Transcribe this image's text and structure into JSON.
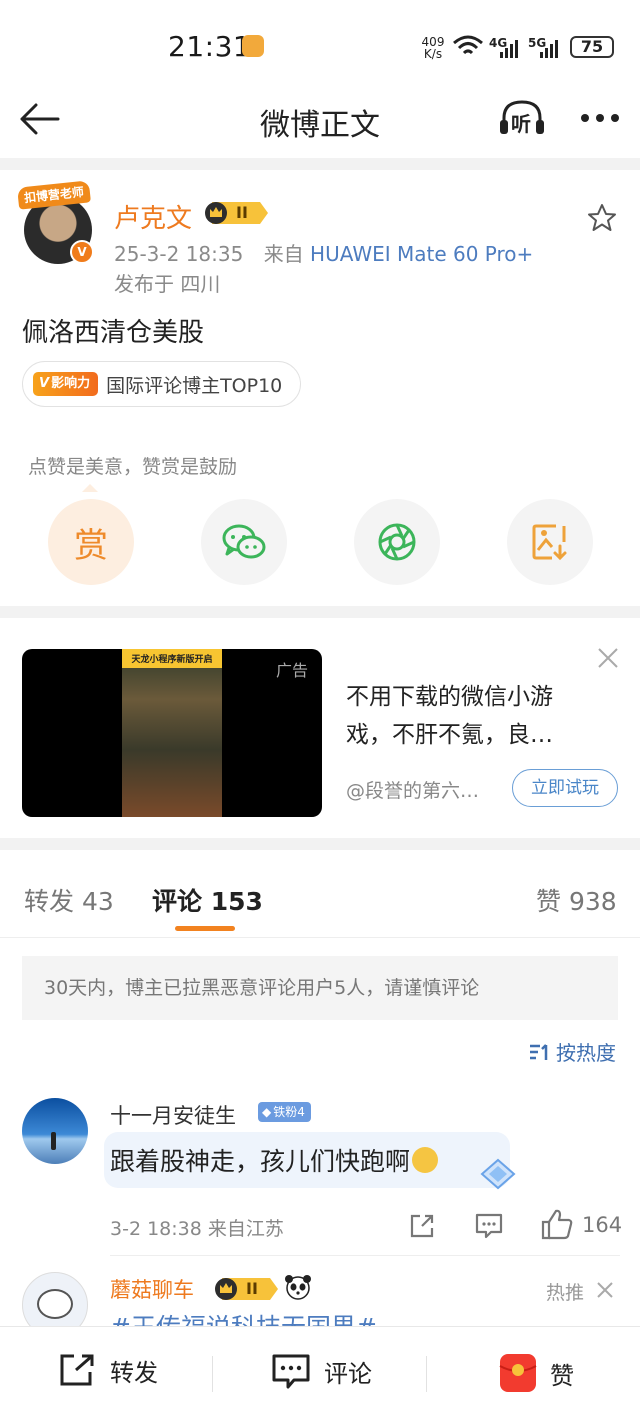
{
  "status_bar": {
    "time": "21:31",
    "net_speed_value": "409",
    "net_speed_unit": "K/s",
    "signal_1_label": "4G",
    "signal_2_label": "5G",
    "battery": "75"
  },
  "nav": {
    "title": "微博正文",
    "listen_label": "听"
  },
  "post": {
    "avatar_ribbon": "扣博营老师",
    "author_name": "卢克文",
    "vip_level": "II",
    "verify_mark": "V",
    "timestamp": "25-3-2 18:35",
    "source_prefix": "来自",
    "device": "HUAWEI Mate 60 Pro+",
    "location": "发布于 四川",
    "content": "佩洛西清仓美股",
    "influence_tag": "影响力",
    "influence_text": "国际评论博主TOP10"
  },
  "reward": {
    "hint": "点赞是美意，赞赏是鼓励",
    "reward_label": "赏"
  },
  "ad": {
    "tag": "广告",
    "banner_text": "天龙小程序新版开启",
    "title": "不用下载的微信小游戏，不肝不氪，良…",
    "source": "@段誉的第六…",
    "button": "立即试玩"
  },
  "tabs": {
    "repost": "转发 43",
    "comment": "评论 153",
    "like": "赞 938"
  },
  "notice": "30天内，博主已拉黑恶意评论用户5人，请谨慎评论",
  "sort": "按热度",
  "comments": [
    {
      "name": "十一月安徒生",
      "badge": "铁粉4",
      "text": "跟着股神走，孩儿们快跑啊",
      "meta": "3-2 18:38 来自江苏",
      "likes": "164"
    },
    {
      "name": "蘑菇聊车",
      "vip_level": "II",
      "hot_tag": "热推",
      "text": "#王传福说科技无国界#"
    }
  ],
  "bottom_bar": {
    "repost": "转发",
    "comment": "评论",
    "like": "赞"
  },
  "colors": {
    "accent_orange": "#f2821f",
    "author_orange": "#ee7a1f",
    "link_blue": "#4d7cbf",
    "wechat_green": "#3cb55a"
  }
}
